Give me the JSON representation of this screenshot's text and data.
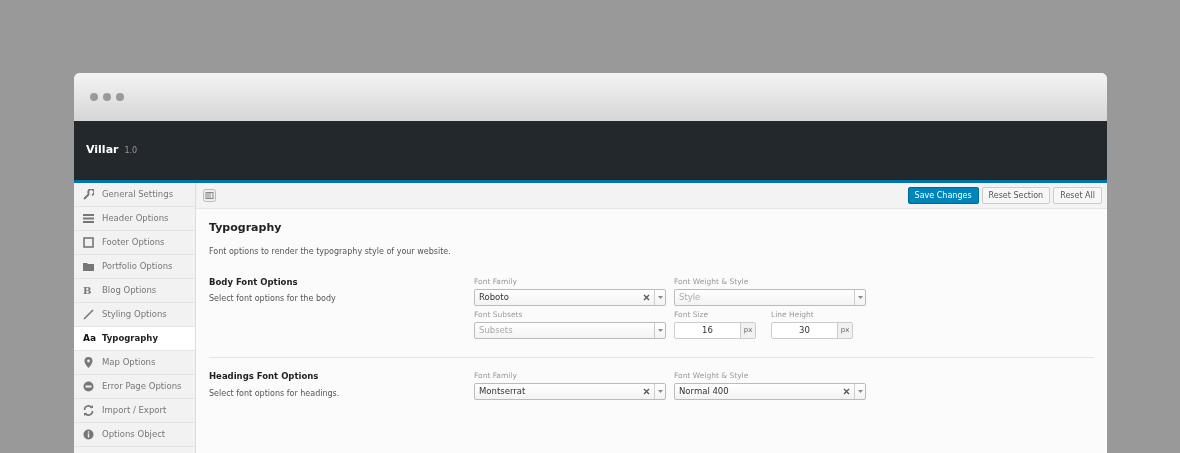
{
  "app": {
    "title": "Villar",
    "version": "1.0"
  },
  "sidebar": {
    "items": [
      {
        "label": "General Settings",
        "selected": false
      },
      {
        "label": "Header Options",
        "selected": false
      },
      {
        "label": "Footer Options",
        "selected": false
      },
      {
        "label": "Portfolio Options",
        "selected": false
      },
      {
        "label": "Blog Options",
        "selected": false,
        "icon_text": "B"
      },
      {
        "label": "Styling Options",
        "selected": false
      },
      {
        "label": "Typography",
        "selected": true,
        "icon_text": "Aa"
      },
      {
        "label": "Map Options",
        "selected": false
      },
      {
        "label": "Error Page Options",
        "selected": false
      },
      {
        "label": "Import / Export",
        "selected": false
      },
      {
        "label": "Options Object",
        "selected": false
      }
    ]
  },
  "toolbar": {
    "buttons": [
      {
        "label": "Save Changes",
        "primary": true
      },
      {
        "label": "Reset Section",
        "primary": false
      },
      {
        "label": "Reset All",
        "primary": false
      }
    ]
  },
  "page": {
    "title": "Typography",
    "description": "Font options to render the typography style of your website."
  },
  "sections": [
    {
      "title": "Body Font Options",
      "subtitle": "Select font options for the body",
      "rows": [
        [
          {
            "kind": "select",
            "label": "Font Family",
            "value": "Roboto",
            "clearable": true
          },
          {
            "kind": "select",
            "label": "Font Weight & Style",
            "placeholder": "Style",
            "clearable": false
          }
        ],
        [
          {
            "kind": "select",
            "label": "Font Subsets",
            "placeholder": "Subsets",
            "clearable": false
          },
          {
            "kind": "number",
            "label": "Font Size",
            "value": "16",
            "unit": "px"
          },
          {
            "kind": "number",
            "label": "Line Height",
            "value": "30",
            "unit": "px"
          }
        ]
      ]
    },
    {
      "title": "Headings Font Options",
      "subtitle": "Select font options for headings.",
      "rows": [
        [
          {
            "kind": "select",
            "label": "Font Family",
            "value": "Montserrat",
            "clearable": true
          },
          {
            "kind": "select",
            "label": "Font Weight & Style",
            "value": "Normal 400",
            "clearable": true
          }
        ]
      ]
    }
  ]
}
